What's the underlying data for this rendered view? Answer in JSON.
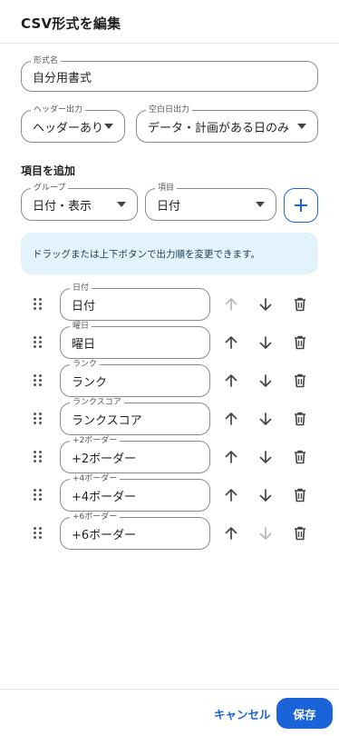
{
  "dialog": {
    "title": "CSV形式を編集"
  },
  "format_name": {
    "label": "形式名",
    "value": "自分用書式"
  },
  "header_output": {
    "label": "ヘッダー出力",
    "value": "ヘッダーあり"
  },
  "blank_day_output": {
    "label": "空白日出力",
    "value": "データ・計画がある日のみ"
  },
  "add_item": {
    "section_label": "項目を追加",
    "group": {
      "label": "グループ",
      "value": "日付・表示"
    },
    "item": {
      "label": "項目",
      "value": "日付"
    },
    "add_button_icon": "plus-icon"
  },
  "info_text": "ドラッグまたは上下ボタンで出力順を変更できます。",
  "columns": [
    {
      "label": "日付",
      "value": "日付",
      "up_enabled": false,
      "down_enabled": true
    },
    {
      "label": "曜日",
      "value": "曜日",
      "up_enabled": true,
      "down_enabled": true
    },
    {
      "label": "ランク",
      "value": "ランク",
      "up_enabled": true,
      "down_enabled": true
    },
    {
      "label": "ランクスコア",
      "value": "ランクスコア",
      "up_enabled": true,
      "down_enabled": true
    },
    {
      "label": "+2ボーダー",
      "value": "+2ボーダー",
      "up_enabled": true,
      "down_enabled": true
    },
    {
      "label": "+4ボーダー",
      "value": "+4ボーダー",
      "up_enabled": true,
      "down_enabled": true
    },
    {
      "label": "+6ボーダー",
      "value": "+6ボーダー",
      "up_enabled": true,
      "down_enabled": false
    }
  ],
  "footer": {
    "cancel_label": "キャンセル",
    "save_label": "保存"
  },
  "colors": {
    "accent": "#1a63d8",
    "info_bg": "#e3f3fb",
    "icon": "#444444",
    "icon_disabled": "#b8b8b8"
  },
  "icons": {
    "drag": "drag-handle-icon",
    "up": "arrow-up-icon",
    "down": "arrow-down-icon",
    "delete": "trash-icon",
    "dropdown": "caret-down-icon"
  }
}
